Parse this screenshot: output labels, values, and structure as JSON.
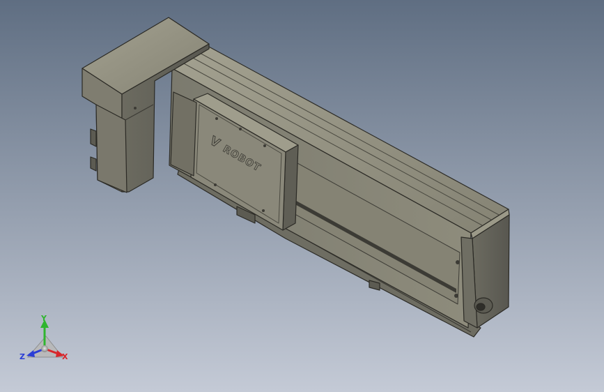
{
  "viewport": {
    "background_top": "#5f6e82",
    "background_bottom": "#c4cad6"
  },
  "model": {
    "logo_text": "ROBOT",
    "logo_mark": "V",
    "colors": {
      "body_light": "#8d8b7a",
      "body_mid": "#77756a",
      "body_dark": "#5b5a50",
      "edge": "#2b2a25",
      "slot": "#3c3b35"
    }
  },
  "triad": {
    "x_label": "X",
    "y_label": "Y",
    "z_label": "Z",
    "x_color": "#d8262b",
    "y_color": "#2fb52f",
    "z_color": "#2b3ed6"
  }
}
